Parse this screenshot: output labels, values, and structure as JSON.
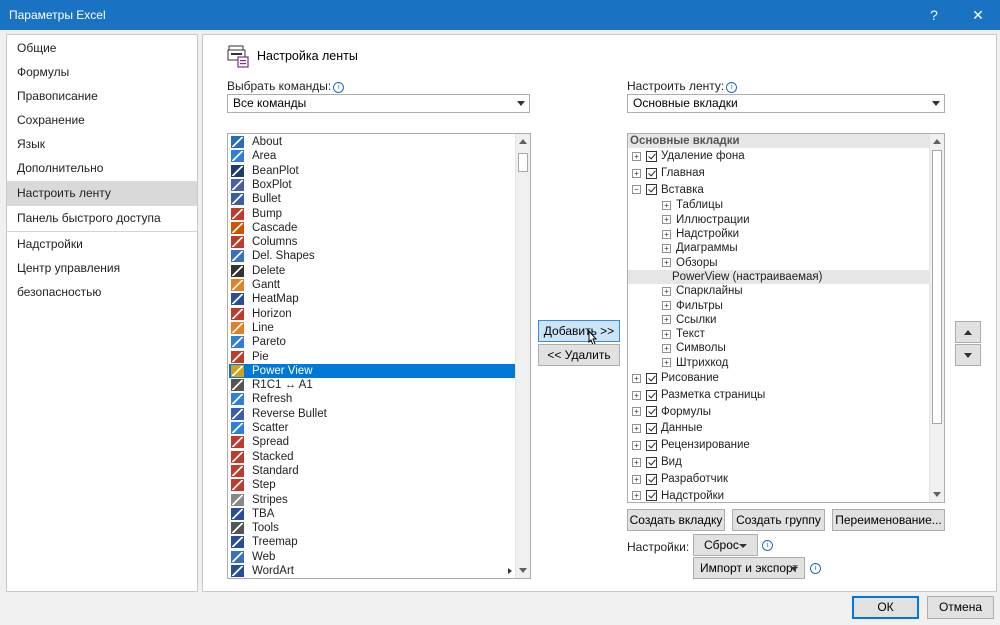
{
  "window": {
    "title": "Параметры Excel",
    "help_label": "?",
    "close_label": "✕"
  },
  "sidebar": {
    "items": [
      {
        "label": "Общие",
        "selected": false
      },
      {
        "label": "Формулы",
        "selected": false
      },
      {
        "label": "Правописание",
        "selected": false
      },
      {
        "label": "Сохранение",
        "selected": false
      },
      {
        "label": "Язык",
        "selected": false
      },
      {
        "label": "Дополнительно",
        "selected": false
      },
      {
        "label": "Настроить ленту",
        "selected": true
      },
      {
        "label": "Панель быстрого доступа",
        "selected": false
      },
      {
        "label": "Надстройки",
        "selected": false
      },
      {
        "label": "Центр управления безопасностью",
        "selected": false
      }
    ]
  },
  "main": {
    "title": "Настройка ленты",
    "choose_label": "Выбрать команды:",
    "choose_value": "Все команды",
    "customize_label": "Настроить ленту:",
    "customize_value": "Основные вкладки",
    "info_glyph": "i"
  },
  "commands": [
    {
      "label": "About",
      "icon": "info-icon",
      "color": "#2b6cb8"
    },
    {
      "label": "Area",
      "icon": "area-chart-icon",
      "color": "#2f7ed8"
    },
    {
      "label": "BeanPlot",
      "icon": "beanplot-icon",
      "color": "#1f3a6e"
    },
    {
      "label": "BoxPlot",
      "icon": "boxplot-icon",
      "color": "#4a5fa8"
    },
    {
      "label": "Bullet",
      "icon": "bullet-chart-icon",
      "color": "#3b5ea8"
    },
    {
      "label": "Bump",
      "icon": "bump-chart-icon",
      "color": "#c0392b"
    },
    {
      "label": "Cascade",
      "icon": "cascade-icon",
      "color": "#d35400"
    },
    {
      "label": "Columns",
      "icon": "columns-icon",
      "color": "#c0392b"
    },
    {
      "label": "Del. Shapes",
      "icon": "delete-shapes-icon",
      "color": "#3a6fc2"
    },
    {
      "label": "Delete",
      "icon": "delete-icon",
      "color": "#333333"
    },
    {
      "label": "Gantt",
      "icon": "gantt-icon",
      "color": "#e67e22"
    },
    {
      "label": "HeatMap",
      "icon": "heatmap-icon",
      "color": "#2a4d9b"
    },
    {
      "label": "Horizon",
      "icon": "horizon-icon",
      "color": "#c0392b"
    },
    {
      "label": "Line",
      "icon": "line-chart-icon",
      "color": "#e67e22"
    },
    {
      "label": "Pareto",
      "icon": "pareto-icon",
      "color": "#2f7ed8"
    },
    {
      "label": "Pie",
      "icon": "pie-chart-icon",
      "color": "#c0392b"
    },
    {
      "label": "Power View",
      "icon": "power-view-icon",
      "color": "#d4a017",
      "selected": true
    },
    {
      "label": "R1C1 ↔ A1",
      "icon": "r1c1-icon",
      "color": "#555555"
    },
    {
      "label": "Refresh",
      "icon": "refresh-icon",
      "color": "#2f7ed8"
    },
    {
      "label": "Reverse Bullet",
      "icon": "reverse-bullet-icon",
      "color": "#3b5ea8"
    },
    {
      "label": "Scatter",
      "icon": "scatter-icon",
      "color": "#2f7ed8"
    },
    {
      "label": "Spread",
      "icon": "spread-icon",
      "color": "#c0392b"
    },
    {
      "label": "Stacked",
      "icon": "stacked-icon",
      "color": "#c0392b"
    },
    {
      "label": "Standard",
      "icon": "standard-icon",
      "color": "#c0392b"
    },
    {
      "label": "Step",
      "icon": "step-chart-icon",
      "color": "#c0392b"
    },
    {
      "label": "Stripes",
      "icon": "stripes-icon",
      "color": "#888888"
    },
    {
      "label": "TBA",
      "icon": "tba-icon",
      "color": "#2a4d9b"
    },
    {
      "label": "Tools",
      "icon": "tools-icon",
      "color": "#555555"
    },
    {
      "label": "Treemap",
      "icon": "treemap-icon",
      "color": "#2a4d9b"
    },
    {
      "label": "Web",
      "icon": "web-icon",
      "color": "#3a6fc2"
    },
    {
      "label": "WordArt",
      "icon": "wordart-icon",
      "color": "#2a4d9b",
      "submenu": true
    }
  ],
  "buttons": {
    "add": "Добавить >>",
    "remove": "<< Удалить",
    "new_tab": "Создать вкладку",
    "new_group": "Создать группу",
    "rename": "Переименование...",
    "settings_label": "Настройки:",
    "reset": "Сброс",
    "import_export": "Импорт и экспорт",
    "ok": "ОК",
    "cancel": "Отмена"
  },
  "ribbon_tree": {
    "header": "Основные вкладки",
    "items": [
      {
        "label": "Удаление фона",
        "level": 0,
        "expander": "+",
        "checked": true
      },
      {
        "label": "Главная",
        "level": 0,
        "expander": "+",
        "checked": true
      },
      {
        "label": "Вставка",
        "level": 0,
        "expander": "−",
        "checked": true
      },
      {
        "label": "Таблицы",
        "level": 1,
        "expander": "+"
      },
      {
        "label": "Иллюстрации",
        "level": 1,
        "expander": "+"
      },
      {
        "label": "Надстройки",
        "level": 1,
        "expander": "+"
      },
      {
        "label": "Диаграммы",
        "level": 1,
        "expander": "+"
      },
      {
        "label": "Обзоры",
        "level": 1,
        "expander": "+"
      },
      {
        "label": "PowerView (настраиваемая)",
        "level": 1,
        "highlight": true
      },
      {
        "label": "Спарклайны",
        "level": 1,
        "expander": "+"
      },
      {
        "label": "Фильтры",
        "level": 1,
        "expander": "+"
      },
      {
        "label": "Ссылки",
        "level": 1,
        "expander": "+"
      },
      {
        "label": "Текст",
        "level": 1,
        "expander": "+"
      },
      {
        "label": "Символы",
        "level": 1,
        "expander": "+"
      },
      {
        "label": "Штрихкод",
        "level": 1,
        "expander": "+"
      },
      {
        "label": "Рисование",
        "level": 0,
        "expander": "+",
        "checked": true
      },
      {
        "label": "Разметка страницы",
        "level": 0,
        "expander": "+",
        "checked": true
      },
      {
        "label": "Формулы",
        "level": 0,
        "expander": "+",
        "checked": true
      },
      {
        "label": "Данные",
        "level": 0,
        "expander": "+",
        "checked": true
      },
      {
        "label": "Рецензирование",
        "level": 0,
        "expander": "+",
        "checked": true
      },
      {
        "label": "Вид",
        "level": 0,
        "expander": "+",
        "checked": true
      },
      {
        "label": "Разработчик",
        "level": 0,
        "expander": "+",
        "checked": true
      },
      {
        "label": "Надстройки",
        "level": 0,
        "expander": "+",
        "checked": true
      }
    ]
  },
  "colors": {
    "titlebar": "#1a73c2",
    "selection": "#0078d7"
  }
}
